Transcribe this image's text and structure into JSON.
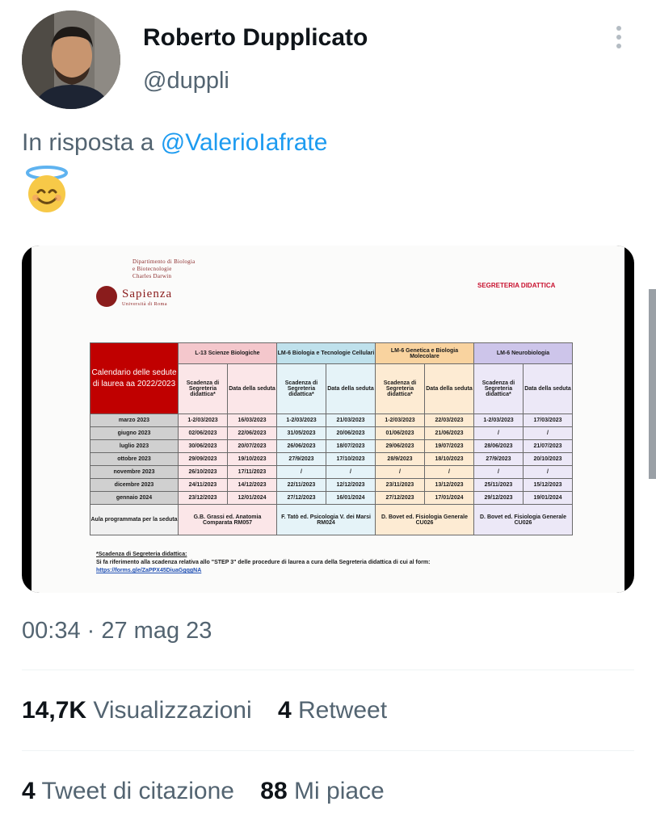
{
  "tweet": {
    "author_name": "Roberto Dupplicato",
    "author_handle": "@duppli",
    "reply_prefix": "In risposta a",
    "reply_to": "@ValerioIafrate",
    "emoji": "😇",
    "timestamp": "00:34 · 27 mag 23",
    "stats": {
      "views_count": "14,7K",
      "views_label": "Visualizzazioni",
      "retweets_count": "4",
      "retweets_label": "Retweet",
      "quotes_count": "4",
      "quotes_label": "Tweet di citazione",
      "likes_count": "88",
      "likes_label": "Mi piace"
    }
  },
  "colors": {
    "handle_gray": "#536471",
    "link_blue": "#1d9bf0",
    "table_red": "#c00000",
    "l13": "#f4c7cc",
    "lm6_bio": "#bfe1ec",
    "lm6_gen": "#f9d39f",
    "lm6_neuro": "#cdc5ea"
  },
  "image": {
    "dept_line1": "Dipartimento di Biologia",
    "dept_line2": "e Biotecnologie",
    "dept_line3": "Charles Darwin",
    "logo": "Sapienza",
    "logo_sub": "Università di Roma",
    "office": "SEGRETERIA DIDATTICA",
    "table": {
      "title": "Calendario delle sedute di laurea aa 2022/2023",
      "programs": [
        "L-13 Scienze Biologiche",
        "LM-6 Biologia e Tecnologie Cellulari",
        "LM-6 Genetica e Biologia Molecolare",
        "LM-6 Neurobiologia"
      ],
      "col_deadline": "Scadenza di Segreteria didattica*",
      "col_date": "Data della seduta",
      "rows": [
        {
          "month": "marzo 2023",
          "cells": [
            "1-2/03/2023",
            "16/03/2023",
            "1-2/03/2023",
            "21/03/2023",
            "1-2/03/2023",
            "22/03/2023",
            "1-2/03/2023",
            "17/03/2023"
          ]
        },
        {
          "month": "giugno 2023",
          "cells": [
            "02/06/2023",
            "22/06/2023",
            "31/05/2023",
            "20/06/2023",
            "01/06/2023",
            "21/06/2023",
            "/",
            "/"
          ]
        },
        {
          "month": "luglio 2023",
          "cells": [
            "30/06/2023",
            "20/07/2023",
            "26/06/2023",
            "18/07/2023",
            "29/06/2023",
            "19/07/2023",
            "28/06/2023",
            "21/07/2023"
          ]
        },
        {
          "month": "ottobre 2023",
          "cells": [
            "29/09/2023",
            "19/10/2023",
            "27/9/2023",
            "17/10/2023",
            "28/9/2023",
            "18/10/2023",
            "27/9/2023",
            "20/10/2023"
          ]
        },
        {
          "month": "novembre 2023",
          "cells": [
            "26/10/2023",
            "17/11/2023",
            "/",
            "/",
            "/",
            "/",
            "/",
            "/"
          ]
        },
        {
          "month": "dicembre 2023",
          "cells": [
            "24/11/2023",
            "14/12/2023",
            "22/11/2023",
            "12/12/2023",
            "23/11/2023",
            "13/12/2023",
            "25/11/2023",
            "15/12/2023"
          ]
        },
        {
          "month": "gennaio 2024",
          "cells": [
            "23/12/2023",
            "12/01/2024",
            "27/12/2023",
            "16/01/2024",
            "27/12/2023",
            "17/01/2024",
            "29/12/2023",
            "19/01/2024"
          ]
        }
      ],
      "aula_label": "Aula programmata per la seduta",
      "aula": [
        "G.B. Grassi ed. Anatomia Comparata RM057",
        "F. Tatò ed. Psicologia V. dei Marsi RM024",
        "D. Bovet ed. Fisiologia Generale CU026",
        "D. Bovet ed. Fisiologia Generale CU026"
      ]
    },
    "note_title": "*Scadenza di Segreteria didattica:",
    "note_text": "Si fa riferimento alla scadenza relativa allo \"STEP 3\" delle procedure di laurea a cura della Segreteria didattica di cui al form:",
    "note_link": "https://forms.gle/ZaPPX45DiuaGgqgNA"
  }
}
